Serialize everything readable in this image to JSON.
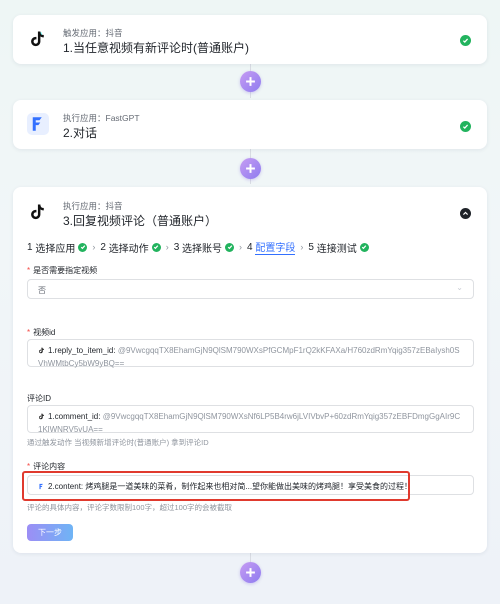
{
  "steps": [
    {
      "tag": "触发应用：抖音",
      "title": "1.当任意视频有新评论时(普通账户)"
    },
    {
      "tag": "执行应用：FastGPT",
      "title": "2.对话"
    },
    {
      "tag": "执行应用：抖音",
      "title": "3.回复视频评论（普通账户）"
    }
  ],
  "stepper": [
    {
      "num": "1",
      "label": "选择应用"
    },
    {
      "num": "2",
      "label": "选择动作"
    },
    {
      "num": "3",
      "label": "选择账号"
    },
    {
      "num": "4",
      "label": "配置字段"
    },
    {
      "num": "5",
      "label": "连接测试"
    }
  ],
  "form": {
    "q1_label": "是否需要指定视频",
    "q1_value": "否",
    "video_label": "视频id",
    "video_key": "1.reply_to_item_id:",
    "video_value": "@9VwcgqqTX8EhamGjN9QlSM790WXsPfGCMpF1rQ2kKFAXa/H760zdRmYqig357zEBaIysh0SVhWMtbCy5bW9yBQ==",
    "comment_label": "评论ID",
    "comment_key": "1.comment_id:",
    "comment_value": "@9VwcgqqTX8EhamGjN9QlSM790WXsNf6LP5B4rw6jLVIVbvP+60zdRmYqig357zEBFDmgGgAIr9C1KlWNRV5vUA==",
    "comment_hint": "通过触发动作 当视频新增评论时(普通账户) 拿到评论ID",
    "content_label": "评论内容",
    "content_key": "2.content:",
    "content_value": "烤鸡腿是一道美味的菜肴，制作起来也相对简...望你能做出美味的烤鸡腿！享受美食的过程！",
    "content_hint": "评论的具体内容，评论字数限制100字，超过100字的会被截取",
    "next_label": "下一步"
  },
  "colors": {
    "accent": "#3370ff",
    "success": "#22b35e",
    "highlight": "#e03a2e",
    "required": "#f54a45"
  }
}
